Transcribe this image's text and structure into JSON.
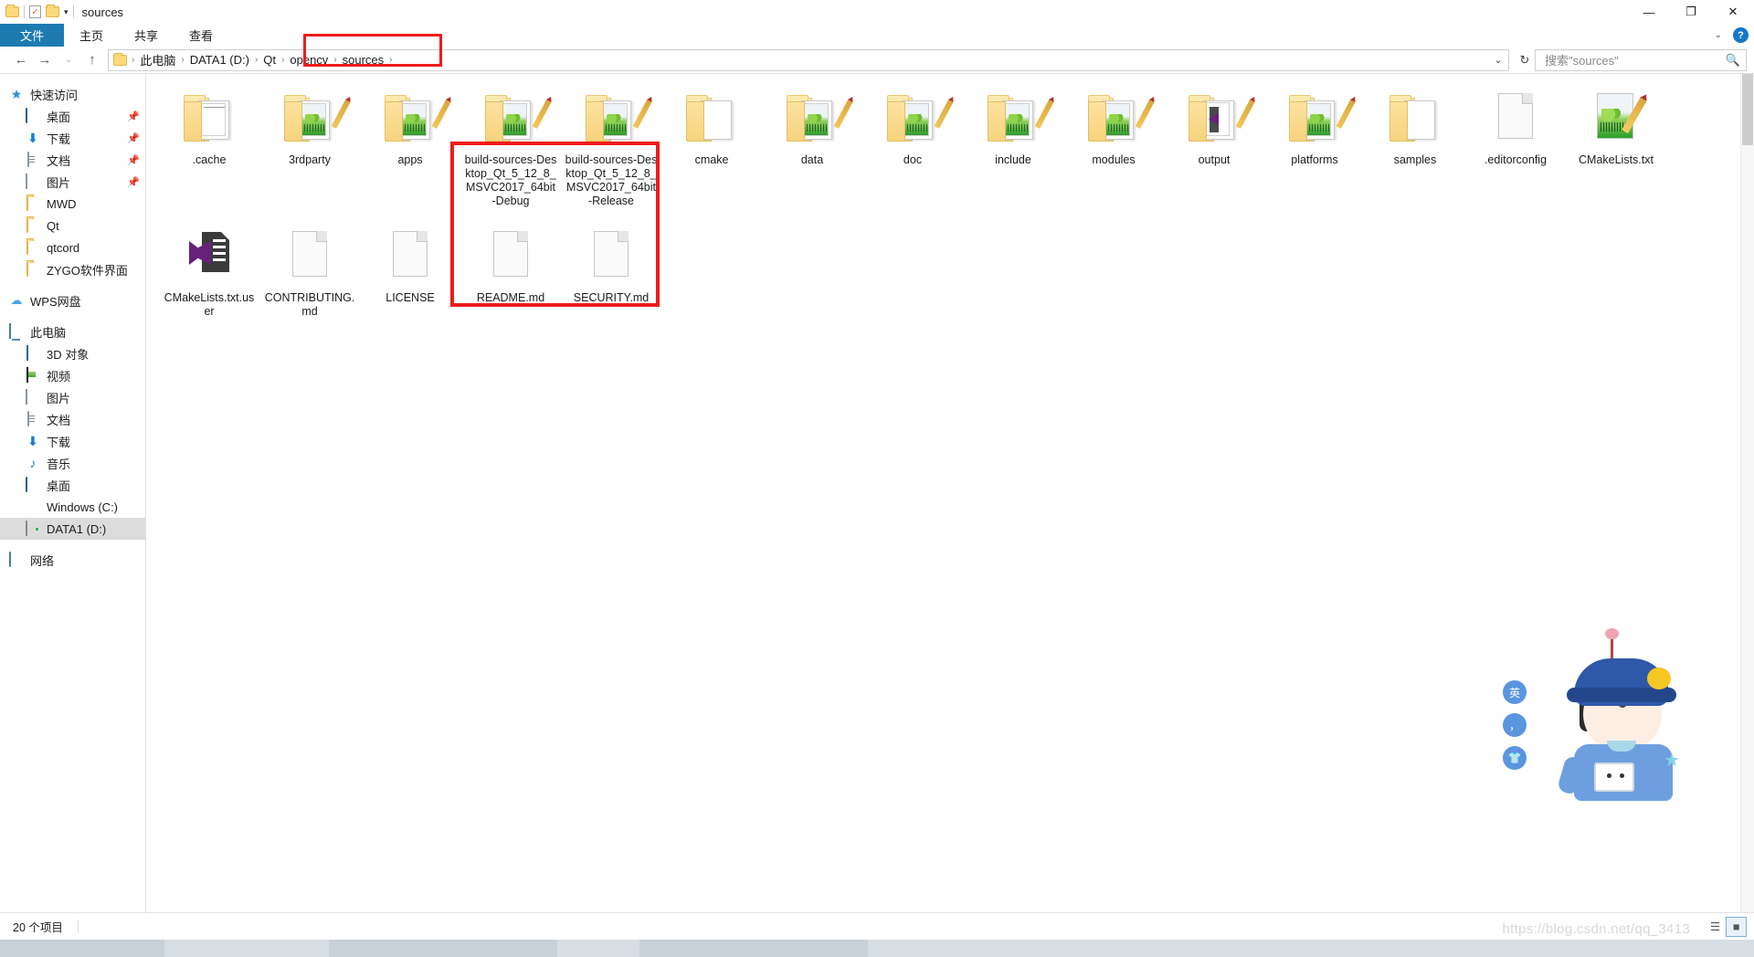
{
  "window": {
    "title": "sources",
    "quick_access_icons": [
      "folder-icon",
      "properties-icon",
      "new-folder-icon"
    ],
    "dropdown_caret": "▾",
    "controls": {
      "minimize": "—",
      "maximize": "❐",
      "close": "✕"
    }
  },
  "ribbon": {
    "tabs": [
      {
        "label": "文件",
        "active": true
      },
      {
        "label": "主页",
        "active": false
      },
      {
        "label": "共享",
        "active": false
      },
      {
        "label": "查看",
        "active": false
      }
    ],
    "collapse_caret": "⌄",
    "help_label": "?"
  },
  "address_bar": {
    "back": "←",
    "forward": "→",
    "recent_caret": "⌄",
    "up": "↑",
    "folder_icon": "folder-icon",
    "crumbs": [
      "此电脑",
      "DATA1 (D:)",
      "Qt",
      "opencv",
      "sources"
    ],
    "crumb_separator": "›",
    "dropdown": "⌄",
    "refresh": "↻"
  },
  "search": {
    "placeholder": "搜索\"sources\"",
    "icon": "search-icon"
  },
  "sidebar": {
    "groups": [
      {
        "header": {
          "label": "快速访问",
          "icon": "star-pin-icon"
        },
        "items": [
          {
            "label": "桌面",
            "icon": "desktop-icon",
            "pinned": true
          },
          {
            "label": "下载",
            "icon": "download-icon",
            "pinned": true
          },
          {
            "label": "文档",
            "icon": "documents-icon",
            "pinned": true
          },
          {
            "label": "图片",
            "icon": "pictures-icon",
            "pinned": true
          },
          {
            "label": "MWD",
            "icon": "folder-icon",
            "pinned": false
          },
          {
            "label": "Qt",
            "icon": "folder-icon",
            "pinned": false
          },
          {
            "label": "qtcord",
            "icon": "folder-icon",
            "pinned": false
          },
          {
            "label": "ZYGO软件界面",
            "icon": "folder-icon",
            "pinned": false
          }
        ]
      },
      {
        "header": {
          "label": "WPS网盘",
          "icon": "cloud-icon"
        },
        "items": []
      },
      {
        "header": {
          "label": "此电脑",
          "icon": "this-pc-icon"
        },
        "items": [
          {
            "label": "3D 对象",
            "icon": "3d-objects-icon"
          },
          {
            "label": "视频",
            "icon": "videos-icon"
          },
          {
            "label": "图片",
            "icon": "pictures-icon"
          },
          {
            "label": "文档",
            "icon": "documents-icon"
          },
          {
            "label": "下载",
            "icon": "download-icon"
          },
          {
            "label": "音乐",
            "icon": "music-icon"
          },
          {
            "label": "桌面",
            "icon": "desktop-icon"
          },
          {
            "label": "Windows (C:)",
            "icon": "windows-drive-icon"
          },
          {
            "label": "DATA1 (D:)",
            "icon": "drive-icon",
            "selected": true
          }
        ]
      },
      {
        "header": {
          "label": "网络",
          "icon": "network-icon"
        },
        "items": []
      }
    ],
    "pin_glyph": "📌"
  },
  "files": [
    {
      "name": ".cache",
      "type": "folder",
      "preview": "lines"
    },
    {
      "name": "3rdparty",
      "type": "folder",
      "preview": "notepadpp"
    },
    {
      "name": "apps",
      "type": "folder",
      "preview": "notepadpp"
    },
    {
      "name": "build-sources-Desktop_Qt_5_12_8_MSVC2017_64bit-Debug",
      "type": "folder",
      "preview": "notepadpp",
      "highlighted": true
    },
    {
      "name": "build-sources-Desktop_Qt_5_12_8_MSVC2017_64bit-Release",
      "type": "folder",
      "preview": "notepadpp",
      "highlighted": true
    },
    {
      "name": "cmake",
      "type": "folder",
      "preview": "plain"
    },
    {
      "name": "data",
      "type": "folder",
      "preview": "notepadpp"
    },
    {
      "name": "doc",
      "type": "folder",
      "preview": "notepadpp"
    },
    {
      "name": "include",
      "type": "folder",
      "preview": "notepadpp"
    },
    {
      "name": "modules",
      "type": "folder",
      "preview": "notepadpp"
    },
    {
      "name": "output",
      "type": "folder",
      "preview": "vs"
    },
    {
      "name": "platforms",
      "type": "folder",
      "preview": "notepadpp"
    },
    {
      "name": "samples",
      "type": "folder",
      "preview": "plain"
    },
    {
      "name": ".editorconfig",
      "type": "file",
      "preview": "blank"
    },
    {
      "name": "CMakeLists.txt",
      "type": "file",
      "preview": "notepadpp-file"
    },
    {
      "name": "CMakeLists.txt.user",
      "type": "file",
      "preview": "vs-file"
    },
    {
      "name": "CONTRIBUTING.md",
      "type": "file",
      "preview": "blank"
    },
    {
      "name": "LICENSE",
      "type": "file",
      "preview": "blank"
    },
    {
      "name": "README.md",
      "type": "file",
      "preview": "blank"
    },
    {
      "name": "SECURITY.md",
      "type": "file",
      "preview": "blank"
    }
  ],
  "annotations": {
    "breadcrumb_box_color": "#ee1c1c",
    "folders_box_color": "#ee1c1c"
  },
  "status_bar": {
    "item_count": "20 个项目",
    "view_details_icon": "details-view-icon",
    "view_large_icons_icon": "large-icons-view-icon"
  },
  "watermark": {
    "text": "https://blog.csdn.net/qq_3413"
  },
  "ime_widget": {
    "buttons": [
      {
        "label": "英",
        "name": "ime-language-toggle"
      },
      {
        "label": "，",
        "name": "ime-punctuation-toggle"
      },
      {
        "label": "👕",
        "name": "ime-skin-button"
      }
    ],
    "mascot": "ime-mascot"
  },
  "colors": {
    "accent": "#1e7bb2",
    "folder": "#fdd97a",
    "selection": "#dcdcdc",
    "annotation": "#ee1c1c"
  }
}
